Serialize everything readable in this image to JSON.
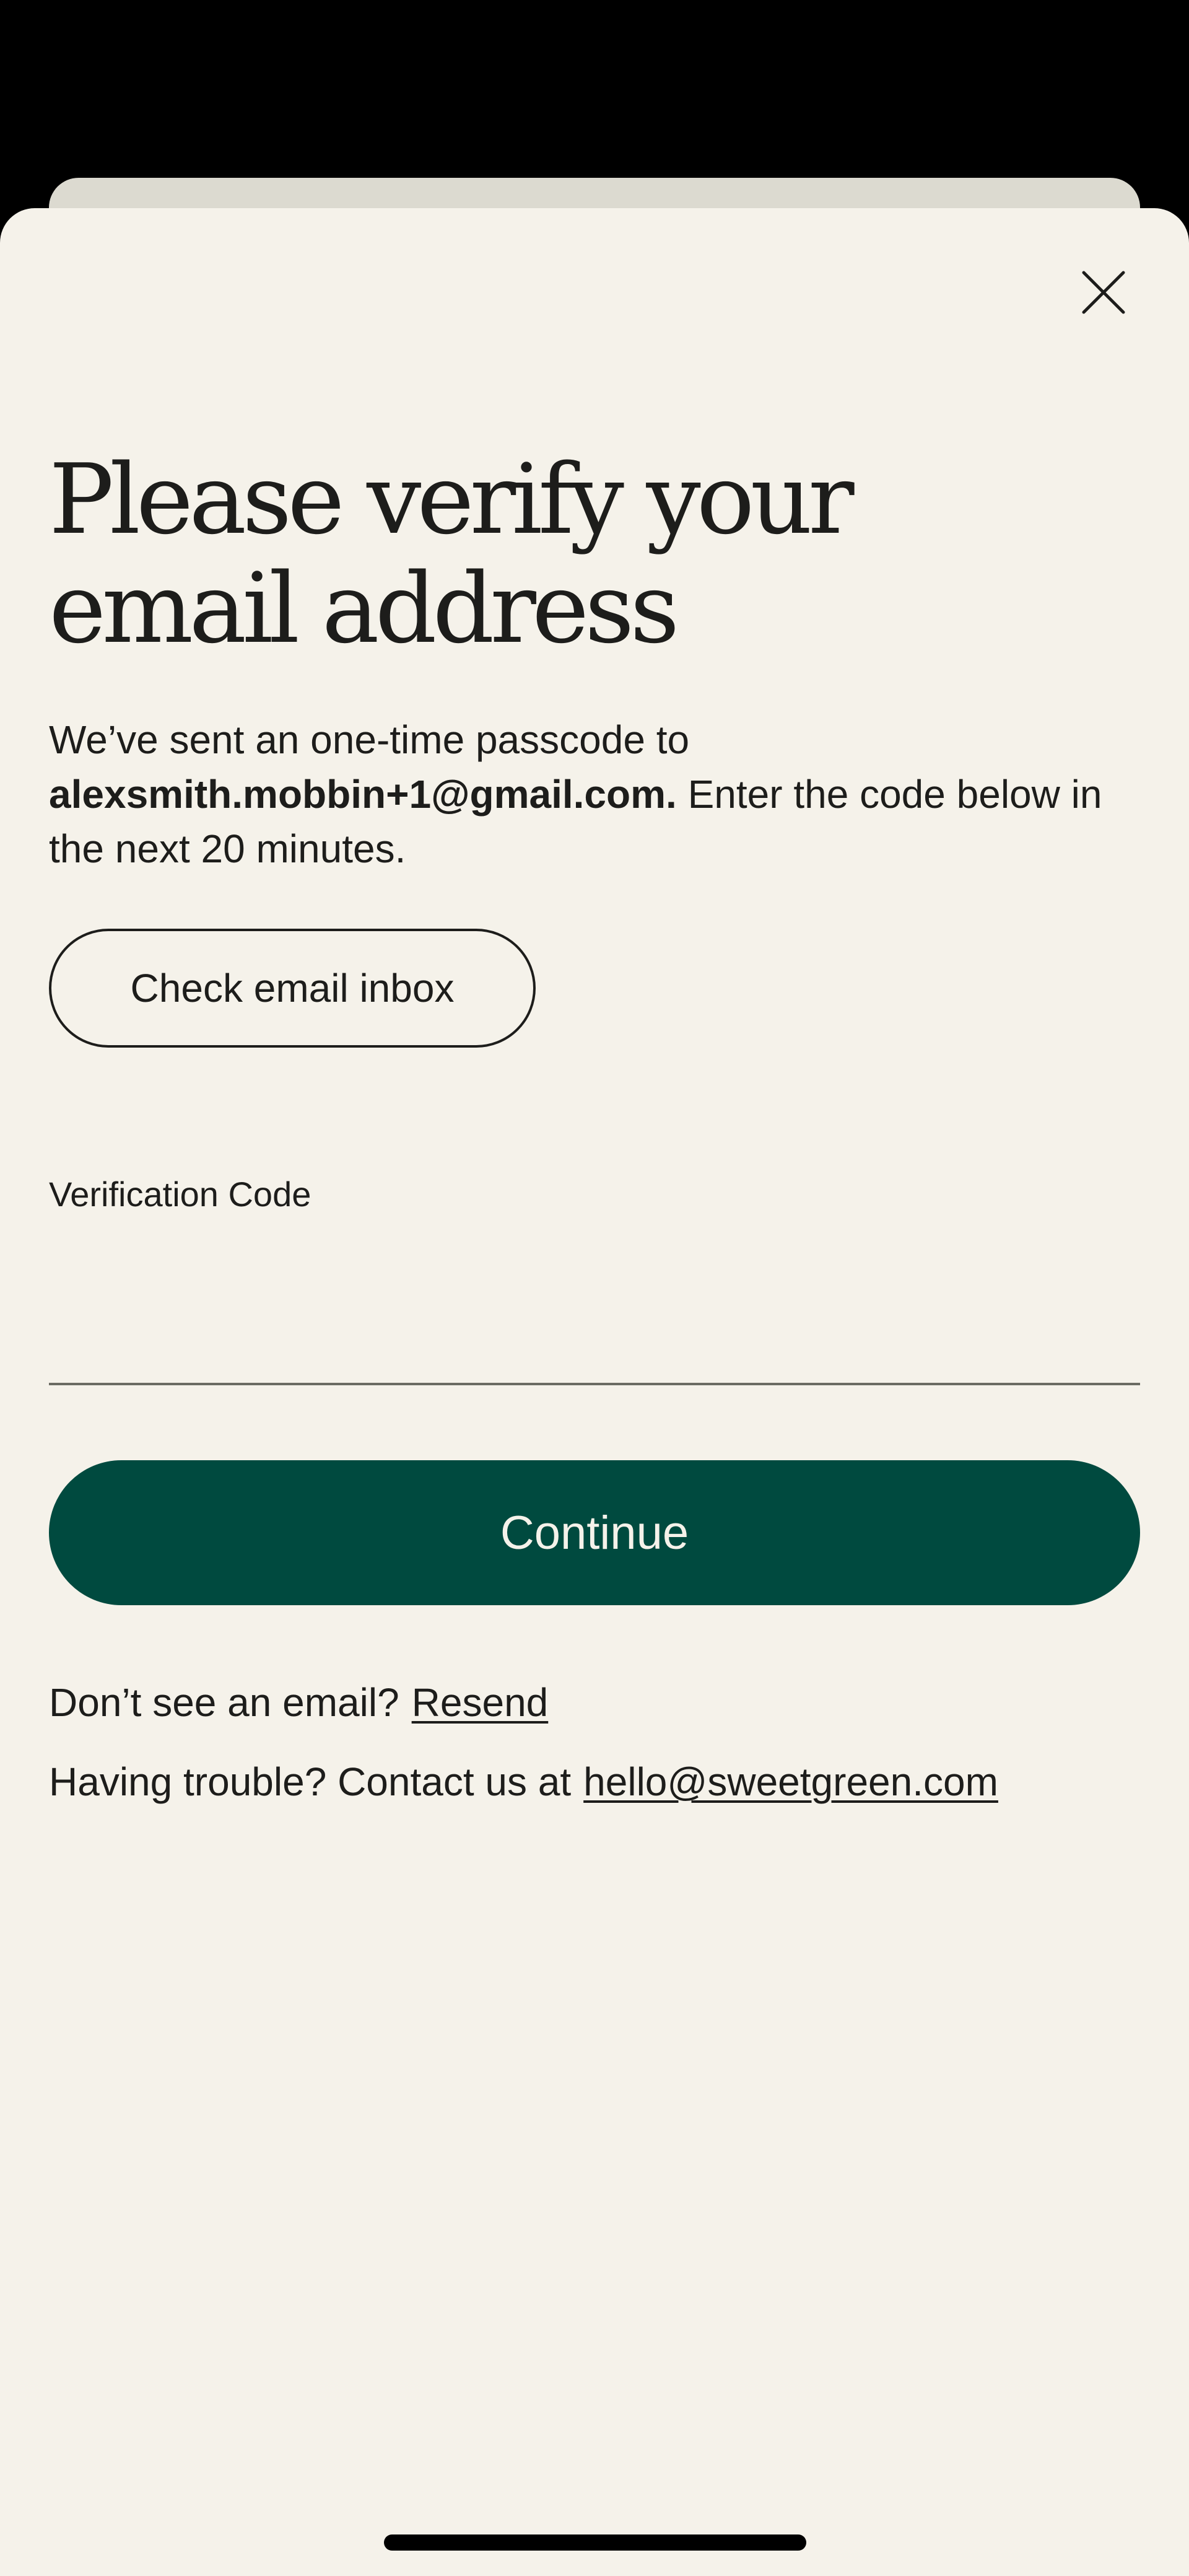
{
  "modal": {
    "close_icon": "close-icon",
    "title": "Please verify your email address",
    "description": {
      "intro": "We’ve sent an one-time passcode to ",
      "email": "alexsmith.mobbin+1@gmail.com.",
      "outro": " Enter the code below in the next 20 minutes."
    },
    "check_inbox_label": "Check email inbox",
    "code_field": {
      "label": "Verification Code",
      "value": "",
      "placeholder": ""
    },
    "continue_label": "Continue",
    "resend_prompt": "Don’t see an email?",
    "resend_link": "Resend",
    "trouble_prompt": "Having trouble? Contact us at",
    "support_email": "hello@sweetgreen.com"
  },
  "colors": {
    "background": "#f5f2ea",
    "back_card": "#dcdad0",
    "primary_button": "#004a3f",
    "primary_button_text": "#f5f2ea",
    "text": "#1d1d1b"
  }
}
